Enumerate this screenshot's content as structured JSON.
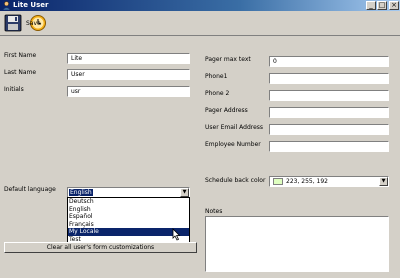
{
  "window": {
    "title": "Lite User",
    "buttons": {
      "minimize": "_",
      "maximize": "□",
      "close": "×"
    }
  },
  "toolbar": {
    "save_label": "Save",
    "icons": [
      "floppy-disk-icon",
      "clock-icon"
    ]
  },
  "left": {
    "first_name_label": "First Name",
    "first_name_value": "Lite",
    "last_name_label": "Last Name",
    "last_name_value": "User",
    "initials_label": "Initials",
    "initials_value": "usr",
    "default_language_label": "Default language",
    "default_language_value": "English",
    "language_options": [
      "Deutsch",
      "English",
      "Español",
      "Français",
      "My Locale",
      "Test"
    ],
    "highlighted_option": "My Locale",
    "clear_button": "Clear all user's form customizations"
  },
  "right": {
    "pager_max_text_label": "Pager max text",
    "pager_max_text_value": "0",
    "phone1_label": "Phone1",
    "phone1_value": "",
    "phone2_label": "Phone 2",
    "phone2_value": "",
    "pager_address_label": "Pager Address",
    "pager_address_value": "",
    "user_email_label": "User Email Address",
    "user_email_value": "",
    "employee_number_label": "Employee Number",
    "employee_number_value": "",
    "schedule_back_color_label": "Schedule back color",
    "schedule_back_color_value": "223, 255, 192",
    "notes_label": "Notes",
    "notes_value": ""
  },
  "colors": {
    "title_bar": "#0a246a",
    "window_bg": "#d4d0c8",
    "selection": "#0a246a",
    "schedule_swatch": "#dfffc0"
  }
}
